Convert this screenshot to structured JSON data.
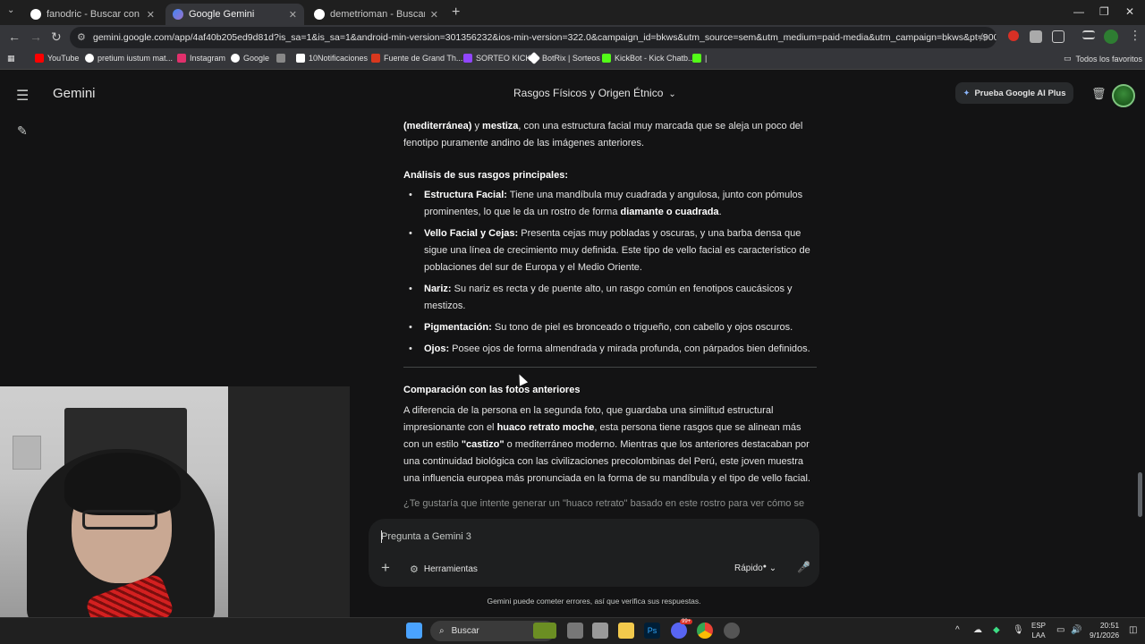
{
  "browser": {
    "tabs": [
      {
        "label": "fanodric - Buscar con Google",
        "close": "✕"
      },
      {
        "label": "Google Gemini",
        "close": "✕"
      },
      {
        "label": "demetrioman - Buscar con Goo",
        "close": "✕"
      }
    ],
    "new_tab": "+",
    "url": "gemini.google.com/app/4af40b205ed9d81d?is_sa=1&is_sa=1&android-min-version=301356232&ios-min-version=322.0&campaign_id=bkws&utm_source=sem&utm_medium=paid-media&utm_campaign=bkws&pt=9008&mt=8&ct=p...",
    "bookmarks": [
      {
        "label": "YouTube",
        "color": "#ff0000"
      },
      {
        "label": "pretium iustum mat...",
        "color": "#ffffff"
      },
      {
        "label": "Instagram",
        "color": "#e1306c"
      },
      {
        "label": "Google",
        "color": "#ffffff"
      },
      {
        "label": "",
        "color": "#888888"
      },
      {
        "label": "10Notificaciones",
        "color": "#ffffff"
      },
      {
        "label": "Fuente de Grand Th...",
        "color": "#d9381e"
      },
      {
        "label": "SORTEO KICK",
        "color": "#9146ff"
      },
      {
        "label": "BotRix | Sorteos",
        "color": "#ffffff"
      },
      {
        "label": "KickBot - Kick Chatb...",
        "color": "#53fc18"
      },
      {
        "label": "|",
        "color": "#53fc18"
      }
    ],
    "all_bookmarks": "Todos los favoritos"
  },
  "gemini": {
    "brand": "Gemini",
    "conversation_title": "Rasgos Físicos y Origen Étnico",
    "promo_button": "Prueba Google AI Plus",
    "intro_lines": {
      "l1_bold1": "(mediterránea)",
      "l1_mid": " y ",
      "l1_bold2": "mestiza",
      "l1_rest": ", con una estructura facial muy marcada que se aleja un poco del",
      "l2": "fenotipo puramente andino de las imágenes anteriores."
    },
    "analysis_heading": "Análisis de sus rasgos principales:",
    "bullets": [
      {
        "title": "Estructura Facial:",
        "text": " Tiene una mandíbula muy cuadrada y angulosa, junto con pómulos prominentes, lo que le da un rostro de forma ",
        "bold_end": "diamante o cuadrada",
        "end": "."
      },
      {
        "title": "Vello Facial y Cejas:",
        "text": " Presenta cejas muy pobladas y oscuras, y una barba densa que sigue una línea de crecimiento muy definida. Este tipo de vello facial es característico de poblaciones del sur de Europa y el Medio Oriente.",
        "bold_end": "",
        "end": ""
      },
      {
        "title": "Nariz:",
        "text": " Su nariz es recta y de puente alto, un rasgo común en fenotipos caucásicos y mestizos.",
        "bold_end": "",
        "end": ""
      },
      {
        "title": "Pigmentación:",
        "text": " Su tono de piel es bronceado o trigueño, con cabello y ojos oscuros.",
        "bold_end": "",
        "end": ""
      },
      {
        "title": "Ojos:",
        "text": " Posee ojos de forma almendrada y mirada profunda, con párpados bien definidos.",
        "bold_end": "",
        "end": ""
      }
    ],
    "comparison_heading": "Comparación con las fotos anteriores",
    "comparison": {
      "p1": "A diferencia de la persona en la segunda foto, que guardaba una similitud estructural impresionante con el ",
      "b1": "huaco retrato moche",
      "p2": ", esta persona tiene rasgos que se alinean más con un estilo ",
      "b2": "\"castizo\"",
      "p3": " o mediterráneo moderno. Mientras que los anteriores destacaban por una continuidad biológica con las civilizaciones precolombinas del Perú, este joven muestra una influencia europea más pronunciada en la forma de su mandíbula y el tipo de vello facial."
    },
    "followup": "¿Te gustaría que intente generar un \"huaco retrato\" basado en este rostro para ver cómo se",
    "composer": {
      "placeholder": "Pregunta a Gemini 3",
      "tools": "Herramientas",
      "mode": "Rápido"
    },
    "disclaimer": "Gemini puede cometer errores, así que verifica sus respuestas."
  },
  "taskbar": {
    "search": "Buscar",
    "lang_top": "ESP",
    "lang_bottom": "LAA",
    "time": "20:51",
    "date": "9/1/2026",
    "discord_badge": "99+"
  }
}
